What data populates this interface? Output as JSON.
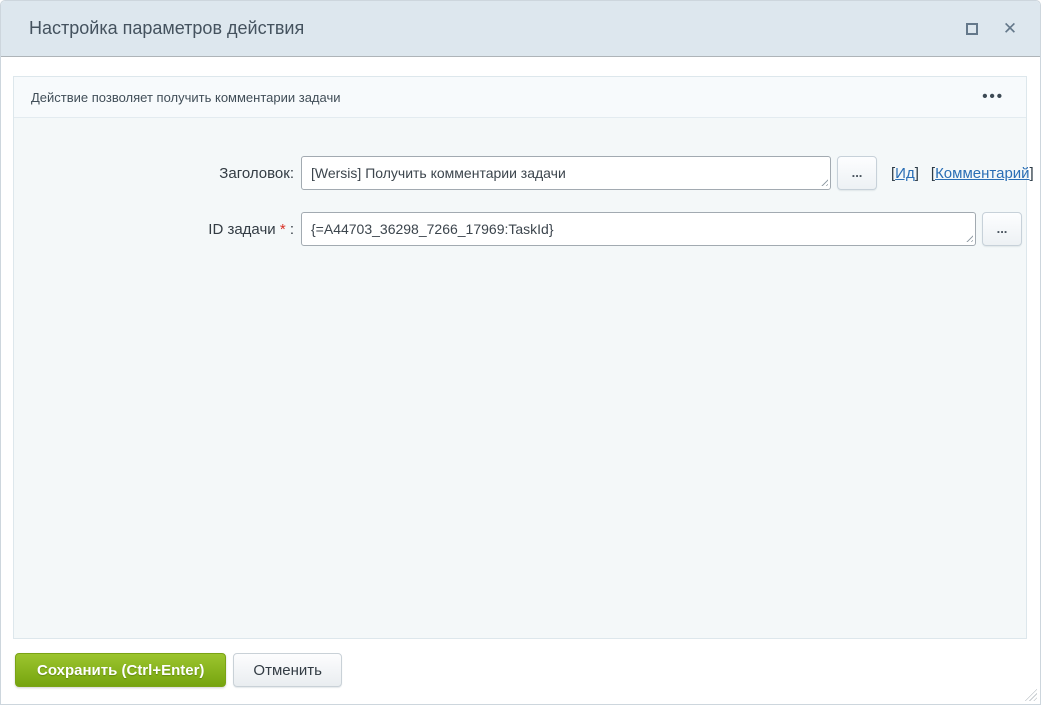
{
  "window": {
    "title": "Настройка параметров действия",
    "controls": {
      "close_glyph": "✕"
    }
  },
  "panel": {
    "description": "Действие позволяет получить комментарии задачи",
    "menu_dots": "•••"
  },
  "form": {
    "title_field": {
      "label": "Заголовок:",
      "value": "[Wersis] Получить комментарии задачи",
      "more_label": "...",
      "links": [
        {
          "open": "[",
          "text": "Ид",
          "close": "]"
        },
        {
          "open": "[",
          "text": "Комментарий",
          "close": "]"
        }
      ]
    },
    "task_id_field": {
      "label_text": "ID задачи ",
      "required_mark": "*",
      "label_suffix": " :",
      "value": "{=A44703_36298_7266_17969:TaskId}",
      "more_label": "..."
    }
  },
  "footer": {
    "save_label": "Сохранить (Ctrl+Enter)",
    "cancel_label": "Отменить"
  },
  "colors": {
    "accent_green": "#84b11c",
    "link_blue": "#2a6eb5",
    "titlebar_bg": "#dde7ee",
    "panel_bg": "#f4f8f9"
  }
}
